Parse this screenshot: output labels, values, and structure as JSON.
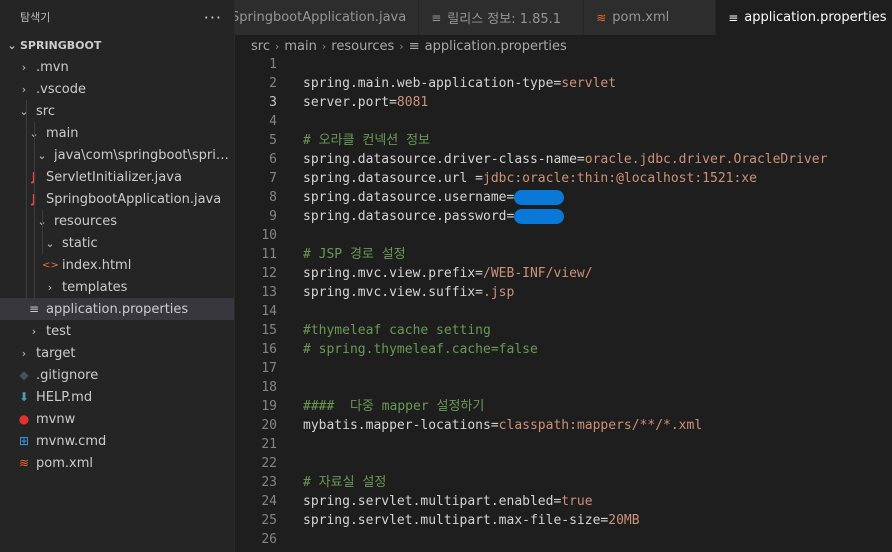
{
  "explorer": {
    "title": "탐색기",
    "more": "···",
    "section": "SPRINGBOOT",
    "items": [
      {
        "label": ".mvn",
        "chevron": "›",
        "icon": ""
      },
      {
        "label": ".vscode",
        "chevron": "›",
        "icon": ""
      },
      {
        "label": "src",
        "chevron": "⌄",
        "icon": ""
      },
      {
        "label": "main",
        "chevron": "⌄",
        "icon": ""
      },
      {
        "label": "java\\com\\springboot\\spring...",
        "chevron": "⌄",
        "icon": ""
      },
      {
        "label": "ServletInitializer.java",
        "chevron": "",
        "icon": "J"
      },
      {
        "label": "SpringbootApplication.java",
        "chevron": "",
        "icon": "J"
      },
      {
        "label": "resources",
        "chevron": "⌄",
        "icon": ""
      },
      {
        "label": "static",
        "chevron": "⌄",
        "icon": ""
      },
      {
        "label": "index.html",
        "chevron": "",
        "icon": "<>"
      },
      {
        "label": "templates",
        "chevron": "›",
        "icon": ""
      },
      {
        "label": "application.properties",
        "chevron": "",
        "icon": "≡"
      },
      {
        "label": "test",
        "chevron": "›",
        "icon": ""
      },
      {
        "label": "target",
        "chevron": "›",
        "icon": ""
      },
      {
        "label": ".gitignore",
        "chevron": "",
        "icon": "◆"
      },
      {
        "label": "HELP.md",
        "chevron": "",
        "icon": "⬇"
      },
      {
        "label": "mvnw",
        "chevron": "",
        "icon": "●"
      },
      {
        "label": "mvnw.cmd",
        "chevron": "",
        "icon": "⊞"
      },
      {
        "label": "pom.xml",
        "chevron": "",
        "icon": "≋"
      }
    ]
  },
  "tabs": [
    {
      "label": "SpringbootApplication.java",
      "icon": ""
    },
    {
      "label": "릴리스 정보: 1.85.1",
      "icon": "≡"
    },
    {
      "label": "pom.xml",
      "icon": "≋"
    },
    {
      "label": "application.properties",
      "icon": "≡"
    }
  ],
  "breadcrumb": {
    "parts": [
      "src",
      "main",
      "resources"
    ],
    "file": "application.properties",
    "file_icon": "≡",
    "sep": "›"
  },
  "editor": {
    "lines": [
      {
        "n": "1"
      },
      {
        "n": "2",
        "key": "spring.main.web-application-type=",
        "val": "servlet"
      },
      {
        "n": "3",
        "key": "server.port=",
        "val": "8081"
      },
      {
        "n": "4"
      },
      {
        "n": "5",
        "comment": "# 오라클 컨넥션 정보"
      },
      {
        "n": "6",
        "key": "spring.datasource.driver-class-name=",
        "val": "oracle.jdbc.driver.OracleDriver"
      },
      {
        "n": "7",
        "key": "spring.datasource.url =",
        "val": "jdbc:oracle:thin:@localhost:1521:xe"
      },
      {
        "n": "8",
        "key": "spring.datasource.username=",
        "redact": true
      },
      {
        "n": "9",
        "key": "spring.datasource.password=",
        "redact": true
      },
      {
        "n": "10"
      },
      {
        "n": "11",
        "comment": "# JSP 경로 설정"
      },
      {
        "n": "12",
        "key": "spring.mvc.view.prefix=",
        "val": "/WEB-INF/view/"
      },
      {
        "n": "13",
        "key": "spring.mvc.view.suffix=",
        "val": ".jsp"
      },
      {
        "n": "14"
      },
      {
        "n": "15",
        "comment": "#thymeleaf cache setting"
      },
      {
        "n": "16",
        "comment": "# spring.thymeleaf.cache=false"
      },
      {
        "n": "17"
      },
      {
        "n": "18"
      },
      {
        "n": "19",
        "comment": "####  다중 mapper 설정하기"
      },
      {
        "n": "20",
        "key": "mybatis.mapper-locations=",
        "val": "classpath:mappers/**/*.xml"
      },
      {
        "n": "21"
      },
      {
        "n": "22"
      },
      {
        "n": "23",
        "comment": "# 자료실 설정"
      },
      {
        "n": "24",
        "key": "spring.servlet.multipart.enabled=",
        "val": "true"
      },
      {
        "n": "25",
        "key": "spring.servlet.multipart.max-file-size=",
        "val": "20MB"
      },
      {
        "n": "26"
      }
    ]
  },
  "colors": {
    "editor_bg": "#1e1e1e",
    "key": "#d4d4d4",
    "value": "#ce9178",
    "comment": "#6a9955",
    "java_icon": "#e54b3c",
    "html_icon": "#e37933",
    "xml_icon": "#f26522",
    "selected_row": "#37373d"
  }
}
